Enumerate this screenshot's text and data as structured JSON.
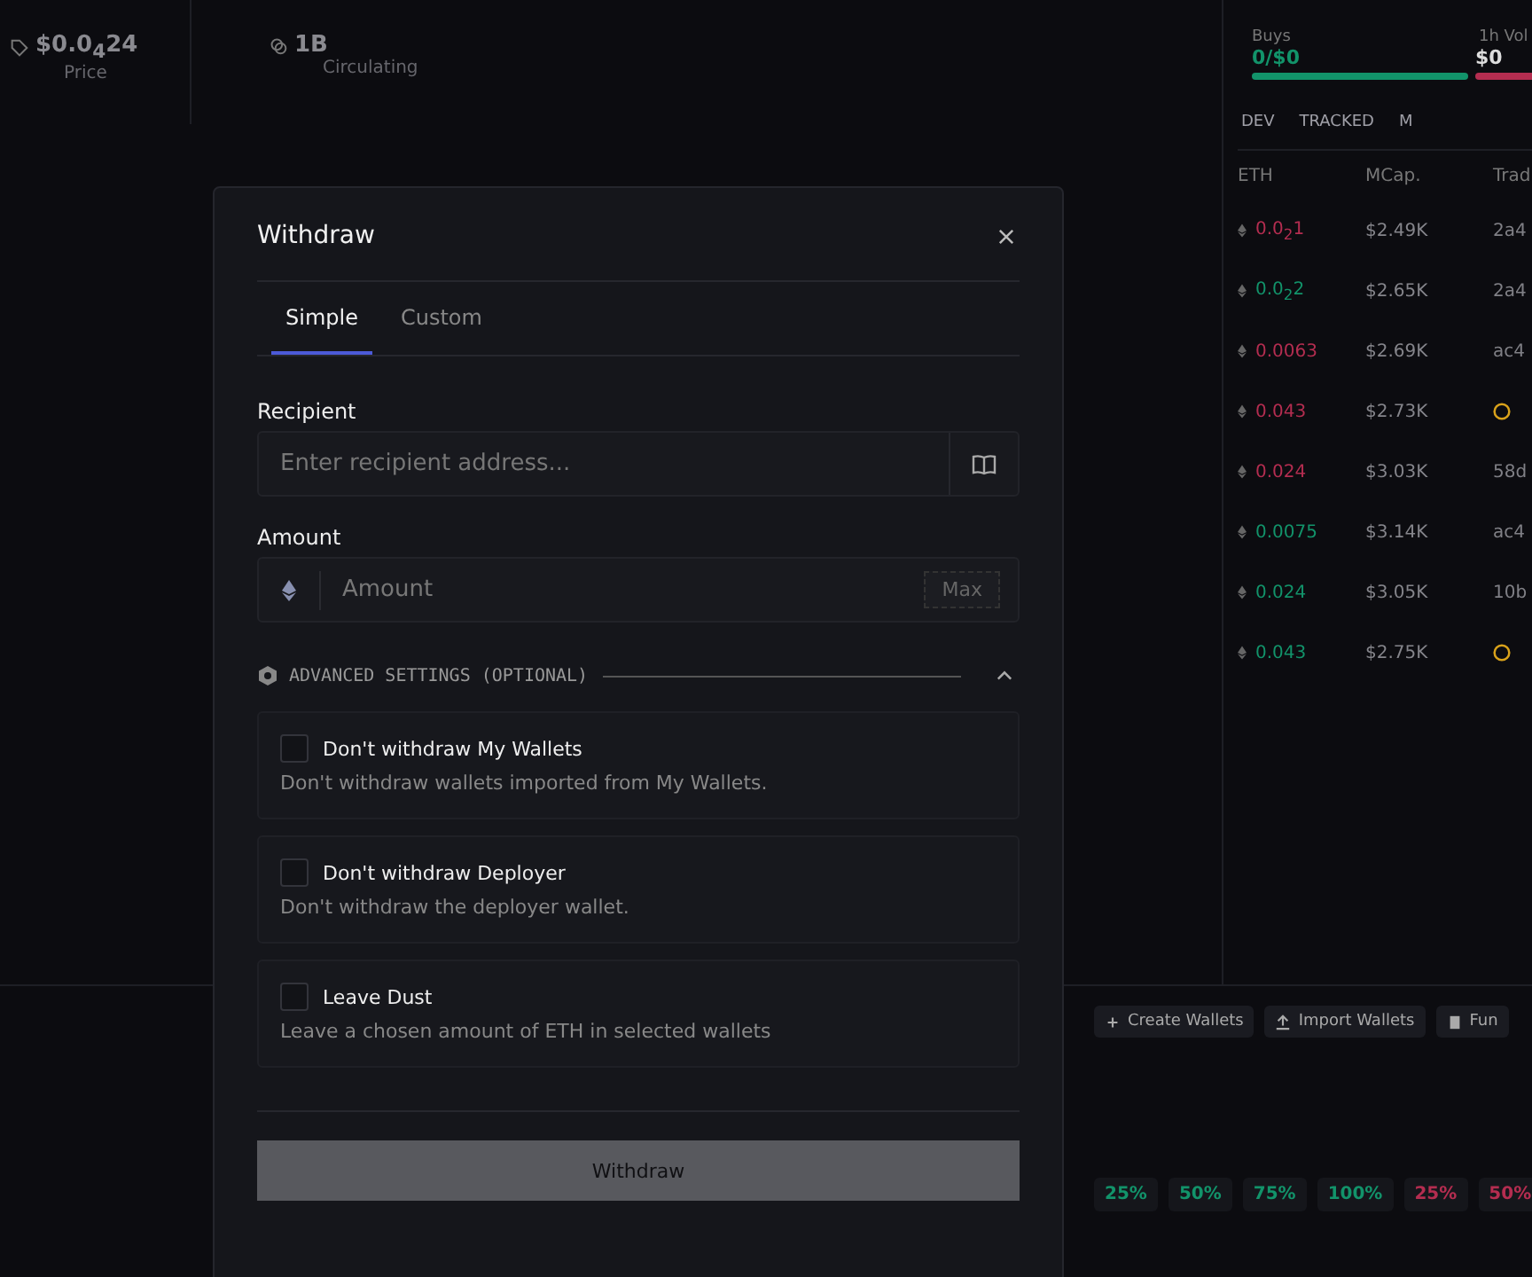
{
  "background": {
    "stats": [
      {
        "value": "$0.0$_{4}$24",
        "label": "Price"
      },
      {
        "value": "1B",
        "label": "Circulating"
      }
    ],
    "flow": [
      {
        "label": "Buys",
        "value": "0/$0",
        "color": "#12936a"
      },
      {
        "label": "1h Vol",
        "value": "$0",
        "color": "#b42d50"
      }
    ],
    "filters": [
      "DEV",
      "TRACKED",
      "M"
    ],
    "columns": [
      "ETH",
      "MCap.",
      "Trad"
    ],
    "rows": [
      {
        "kind": "text",
        "eth": "0.0$_{2}$1",
        "color": "#b42d50",
        "mcap": "$2.49K",
        "col3": "2a4"
      },
      {
        "kind": "text",
        "eth": "0.0$_{2}$2",
        "color": "#12936a",
        "mcap": "$2.65K",
        "col3": "2a4"
      },
      {
        "kind": "text",
        "eth": "0.0063",
        "color": "#b42d50",
        "mcap": "$2.69K",
        "col3": "ac4"
      },
      {
        "kind": "coin",
        "eth": "0.043",
        "color": "#b42d50",
        "mcap": "$2.73K"
      },
      {
        "kind": "text",
        "eth": "0.024",
        "color": "#b42d50",
        "mcap": "$3.03K",
        "col3": "58d"
      },
      {
        "kind": "text",
        "eth": "0.0075",
        "color": "#12936a",
        "mcap": "$3.14K",
        "col3": "ac4"
      },
      {
        "kind": "text",
        "eth": "0.024",
        "color": "#12936a",
        "mcap": "$3.05K",
        "col3": "10b"
      },
      {
        "kind": "coin",
        "eth": "0.043",
        "color": "#12936a",
        "mcap": "$2.75K"
      }
    ],
    "actions": [
      "Create Wallets",
      "Import Wallets",
      "Fun"
    ],
    "presets": [
      {
        "label": "25%",
        "color": "#12936a"
      },
      {
        "label": "50%",
        "color": "#12936a"
      },
      {
        "label": "75%",
        "color": "#12936a"
      },
      {
        "label": "100%",
        "color": "#12936a"
      },
      {
        "label": "25%",
        "color": "#b42d50"
      },
      {
        "label": "50%",
        "color": "#b42d50"
      }
    ]
  },
  "dialog": {
    "title": "Withdraw",
    "tabs": [
      {
        "label": "Simple",
        "selected": true
      },
      {
        "label": "Custom",
        "selected": false
      }
    ],
    "recipient": {
      "label": "Recipient",
      "placeholder": "Enter recipient address..."
    },
    "amount": {
      "label": "Amount",
      "placeholder": "Amount",
      "max": "Max"
    },
    "advanced": {
      "title": "ADVANCED SETTINGS (OPTIONAL)",
      "expanded": true
    },
    "options": [
      {
        "title": "Don't withdraw My Wallets",
        "description": "Don't withdraw wallets imported from My Wallets.",
        "checked": false
      },
      {
        "title": "Don't withdraw Deployer",
        "description": "Don't withdraw the deployer wallet.",
        "checked": false
      },
      {
        "title": "Leave Dust",
        "description": "Leave a chosen amount of ETH in selected wallets",
        "checked": false
      }
    ],
    "submit": {
      "label": "Withdraw",
      "disabled": true
    }
  }
}
